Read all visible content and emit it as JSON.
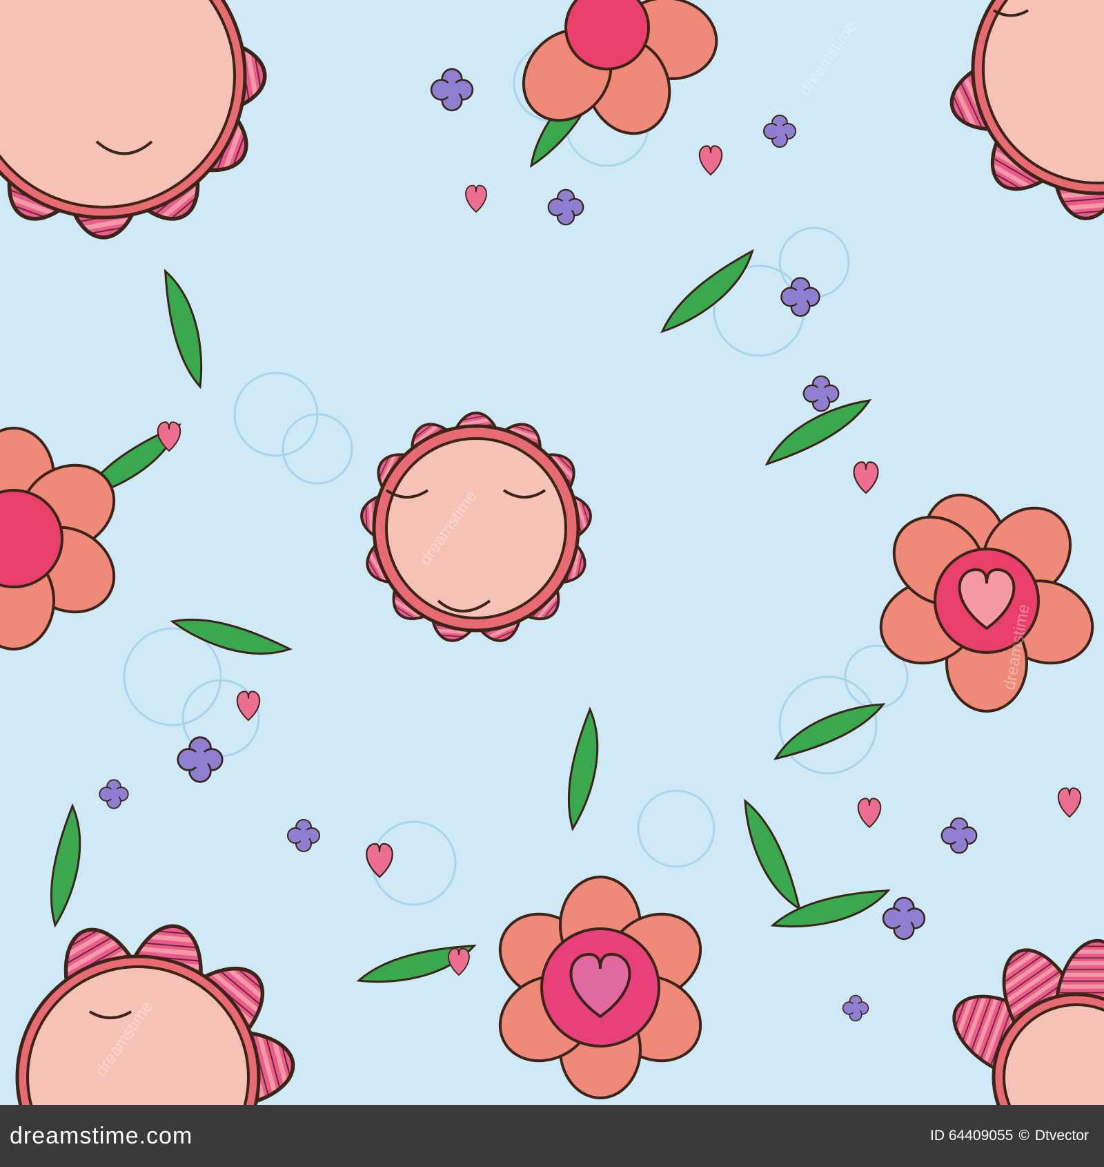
{
  "illustration": {
    "description_colors": {
      "background": "#cfe9f7",
      "scribble": "#9fd0ec",
      "face": "#f6c2b6",
      "petal_pink": "#e8407a",
      "petal_coral": "#ef8a7a",
      "leaf": "#3aa84f",
      "small_flower": "#8f7fd0",
      "heart": "#ec6f92",
      "outline": "#3b2418"
    },
    "watermark_text": "dreamstime"
  },
  "footer": {
    "logo": "dreamstime.com",
    "image_id": "ID 64409055",
    "separator": "©",
    "author": "Dtvector"
  }
}
